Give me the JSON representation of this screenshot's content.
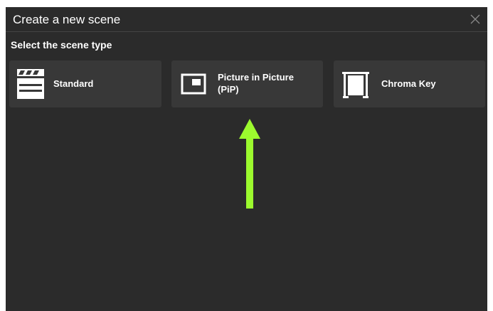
{
  "dialog": {
    "title": "Create a new scene",
    "close_icon": "close-icon"
  },
  "section": {
    "label": "Select the scene type"
  },
  "scene_types": [
    {
      "label": "Standard",
      "icon": "clapperboard-icon"
    },
    {
      "label_line1": "Picture in Picture",
      "label_line2": "(PiP)",
      "icon": "picture-in-picture-icon"
    },
    {
      "label": "Chroma Key",
      "icon": "green-screen-icon"
    }
  ],
  "annotation": {
    "arrow_color": "#9cfa2e",
    "arrow_icon": "arrow-up-icon"
  },
  "colors": {
    "dialog_background": "#2b2b2b",
    "card_background": "#383838",
    "text": "#ffffff"
  }
}
